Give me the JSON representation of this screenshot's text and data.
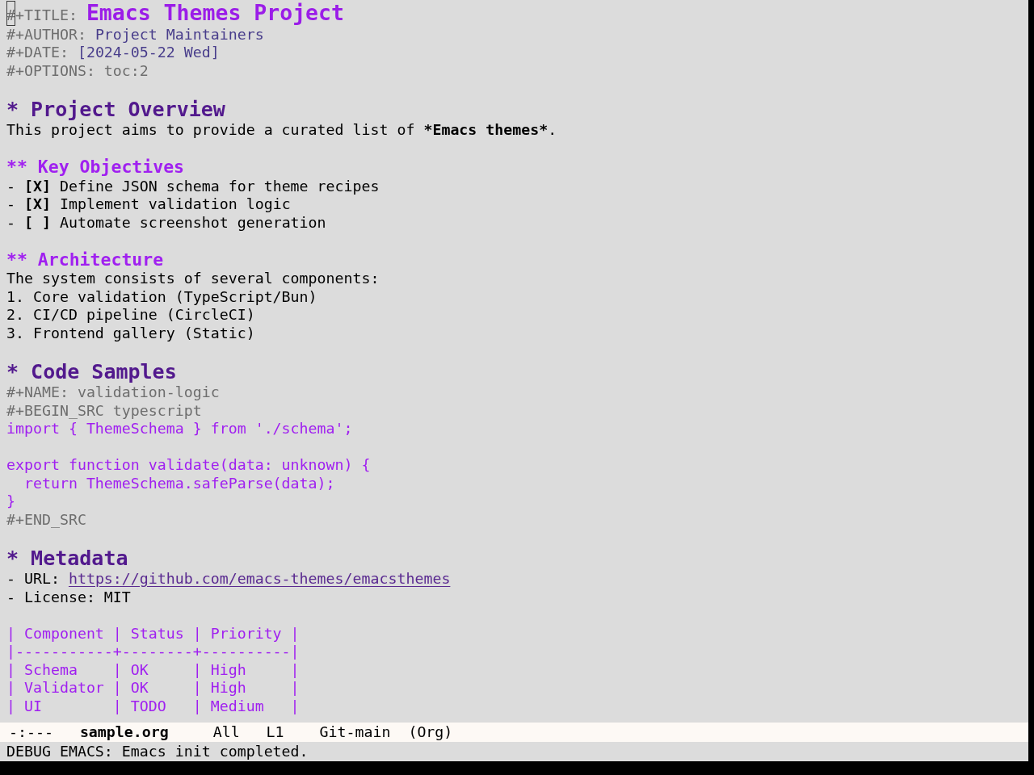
{
  "buffer": {
    "keywords": [
      {
        "kind": "title",
        "keyword": "#+TITLE:",
        "value": "Emacs Themes Project",
        "cursor": true
      },
      {
        "kind": "author",
        "keyword": "#+AUTHOR:",
        "value": "Project Maintainers",
        "cursor": false
      },
      {
        "kind": "date",
        "keyword": "#+DATE:",
        "value": "[2024-05-22 Wed]",
        "cursor": false
      },
      {
        "kind": "option",
        "keyword": "#+OPTIONS:",
        "value": "toc:2",
        "cursor": false
      }
    ],
    "sections": [
      {
        "kind": "h1",
        "heading": "* Project Overview",
        "blocks": [
          {
            "kind": "paragraph",
            "parts": [
              {
                "text": "This project aims to provide a curated list of ",
                "bold": false
              },
              {
                "text": "*Emacs themes*",
                "bold": true
              },
              {
                "text": ".",
                "bold": false
              }
            ]
          }
        ]
      },
      {
        "kind": "h2",
        "heading": "** Key Objectives",
        "blocks": [
          {
            "kind": "checklist",
            "items": [
              "- **[X]** Define JSON schema for theme recipes",
              "- **[X]** Implement validation logic",
              "- **[ ]** Automate screenshot generation"
            ]
          }
        ]
      },
      {
        "kind": "h2",
        "heading": "** Architecture",
        "blocks": [
          {
            "kind": "numbered",
            "intro": "The system consists of several components:",
            "items": [
              "1. Core validation (TypeScript/Bun)",
              "2. CI/CD pipeline (CircleCI)",
              "3. Frontend gallery (Static)"
            ]
          }
        ]
      },
      {
        "kind": "h1",
        "heading": "* Code Samples",
        "blocks": [
          {
            "kind": "src",
            "name_line": "#+NAME: validation-logic",
            "begin_line": "#+BEGIN_SRC typescript",
            "chunks": [
              [
                "import { ThemeSchema } from './schema';"
              ],
              [
                "export function validate(data: unknown) {",
                "  return ThemeSchema.safeParse(data);",
                "}"
              ]
            ],
            "end_line": "#+END_SRC"
          }
        ]
      },
      {
        "kind": "h1",
        "heading": "* Metadata",
        "blocks": [
          {
            "kind": "list",
            "items": [
              {
                "kind": "link",
                "label": "- URL:",
                "link": "https://github.com/emacs-themes/emacsthemes"
              },
              {
                "kind": "text",
                "label": "- License:",
                "value": "MIT"
              }
            ]
          },
          {
            "kind": "table",
            "separator": "|",
            "columns": [
              "Component",
              "Status",
              "Priority"
            ],
            "rule": "|-----------+--------+----------|",
            "rows": [
              [
                "Schema",
                "OK",
                "High"
              ],
              [
                "Validator",
                "OK",
                "High"
              ],
              [
                "UI",
                "TODO",
                "Medium"
              ]
            ]
          }
        ]
      }
    ]
  },
  "mode_line": [
    {
      "kind": "status",
      "text": "-:---"
    },
    {
      "kind": "buffer",
      "text": "sample.org"
    },
    {
      "kind": "position",
      "text": "All"
    },
    {
      "kind": "line",
      "text": "L1"
    },
    {
      "kind": "vc",
      "text": "Git-main"
    },
    {
      "kind": "mode",
      "text": "(Org)"
    }
  ],
  "echo_area": "DEBUG EMACS: Emacs init completed."
}
